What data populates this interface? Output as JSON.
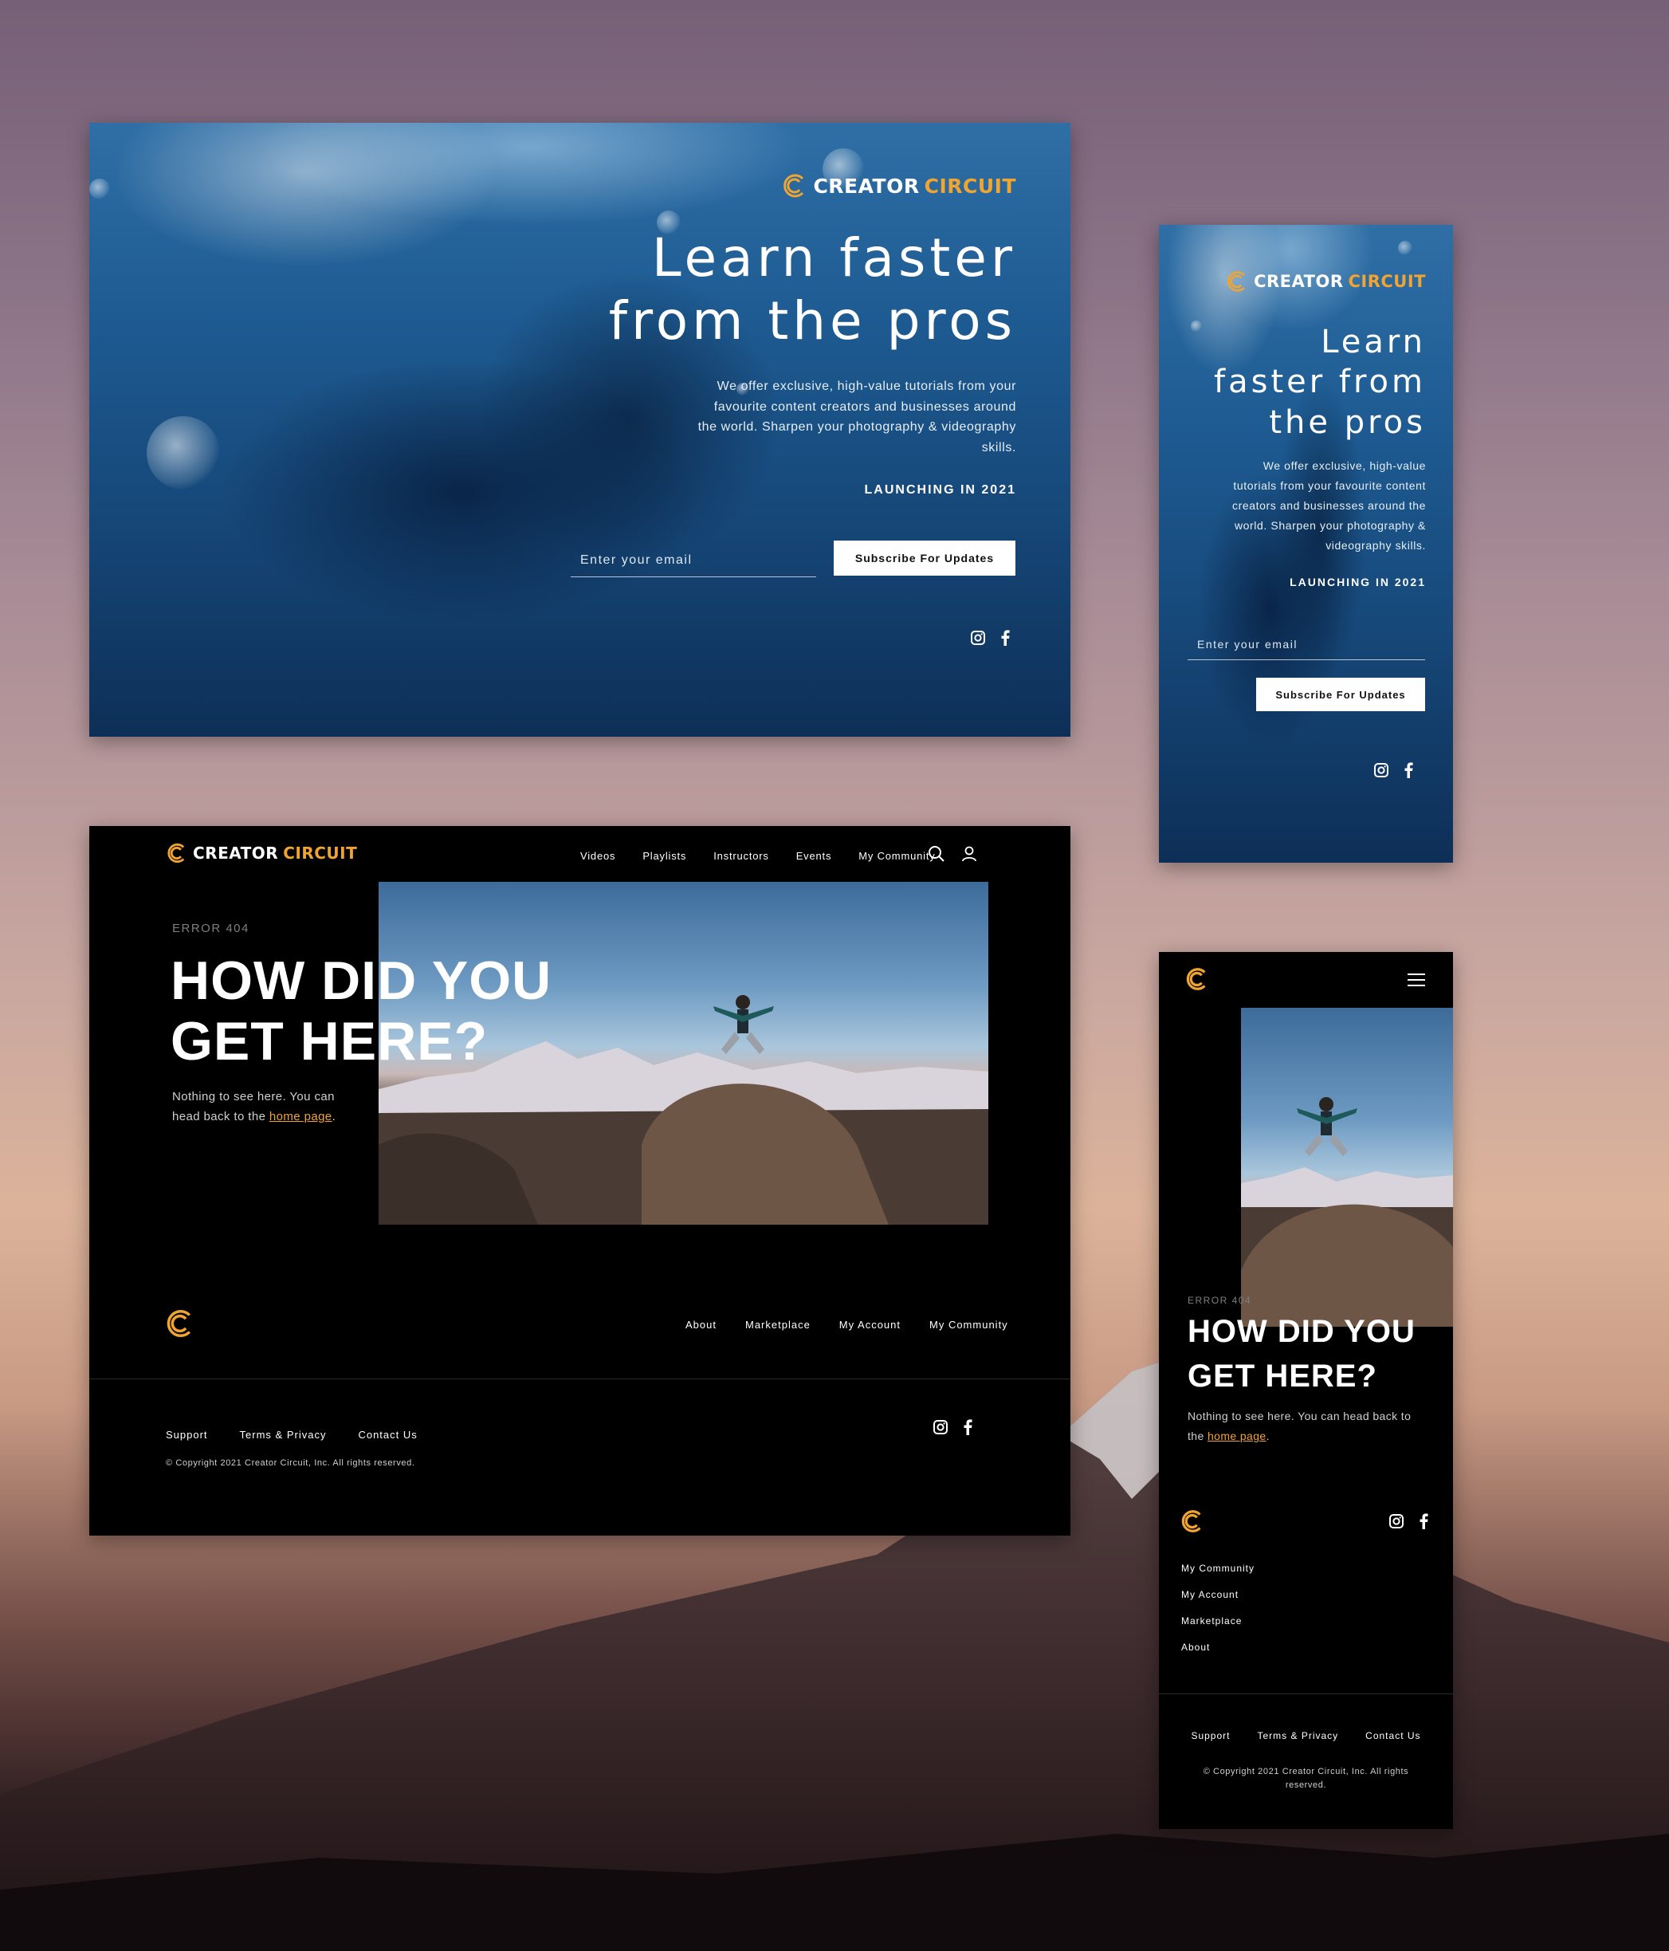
{
  "brand": {
    "name_white": "CREATOR",
    "name_orange": "CIRCUIT",
    "accent": "#f0a431"
  },
  "coming_soon_desktop": {
    "title_line1": "Learn faster",
    "title_line2": "from the pros",
    "body_lines": [
      "We offer exclusive, high-value tutorials from your",
      "favourite content creators and businesses around",
      "the world. Sharpen your photography & videography",
      "skills."
    ],
    "launch": "LAUNCHING IN 2021",
    "email_placeholder": "Enter your email",
    "subscribe_label": "Subscribe For Updates"
  },
  "coming_soon_mobile": {
    "title_lines": [
      "Learn",
      "faster from",
      "the pros"
    ],
    "body_lines": [
      "We offer exclusive, high-value",
      "tutorials from your favourite content",
      "creators and businesses around the",
      "world. Sharpen your photography &",
      "videography skills."
    ],
    "launch": "LAUNCHING IN 2021",
    "email_placeholder": "Enter your email",
    "subscribe_label": "Subscribe For Updates"
  },
  "error_desktop": {
    "nav": [
      "Videos",
      "Playlists",
      "Instructors",
      "Events",
      "My Community"
    ],
    "label": "ERROR 404",
    "title_line1": "HOW DID YOU",
    "title_line2": "GET HERE?",
    "text_line1": "Nothing to see here. You can",
    "text_line2_prefix": "head back to the ",
    "link": "home page",
    "period": ".",
    "footer_links": [
      "About",
      "Marketplace",
      "My Account",
      "My Community"
    ],
    "bottom_links": [
      "Support",
      "Terms & Privacy",
      "Contact Us"
    ],
    "copyright": "© Copyright 2021 Creator Circuit, Inc. All rights reserved."
  },
  "error_mobile": {
    "label": "ERROR 404",
    "title_line1": "HOW DID YOU",
    "title_line2": "GET HERE?",
    "text_line1": "Nothing to see here. You can head back to",
    "text_line2_prefix": "the ",
    "link": "home page",
    "period": ".",
    "footer_links": [
      "My Community",
      "My Account",
      "Marketplace",
      "About"
    ],
    "bottom_links": [
      "Support",
      "Terms & Privacy",
      "Contact Us"
    ],
    "copyright_line1": "© Copyright 2021 Creator Circuit, Inc. All rights",
    "copyright_line2": "reserved."
  }
}
